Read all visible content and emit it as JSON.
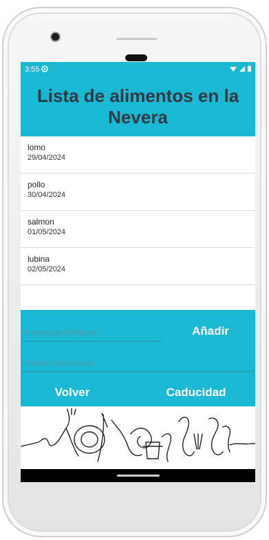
{
  "status_bar": {
    "time": "3:55",
    "icons": [
      "settings-gear-icon",
      "wifi-icon",
      "cell-signal-icon",
      "battery-icon"
    ]
  },
  "app": {
    "title": "Lista de alimentos en la Nevera",
    "header_color": "#1ab8d2",
    "title_color": "#2f3a44"
  },
  "foods": [
    {
      "name": "lomo",
      "date": "29/04/2024"
    },
    {
      "name": "pollo",
      "date": "30/04/2024"
    },
    {
      "name": "salmon",
      "date": "01/05/2024"
    },
    {
      "name": "lubina",
      "date": "02/05/2024"
    }
  ],
  "form": {
    "food_placeholder": "Inserta un Alimento",
    "food_value": "",
    "date_placeholder": "Inserta Caducidad",
    "date_value": "",
    "add_label": "Añadir",
    "back_label": "Volver",
    "expiry_label": "Caducidad"
  }
}
